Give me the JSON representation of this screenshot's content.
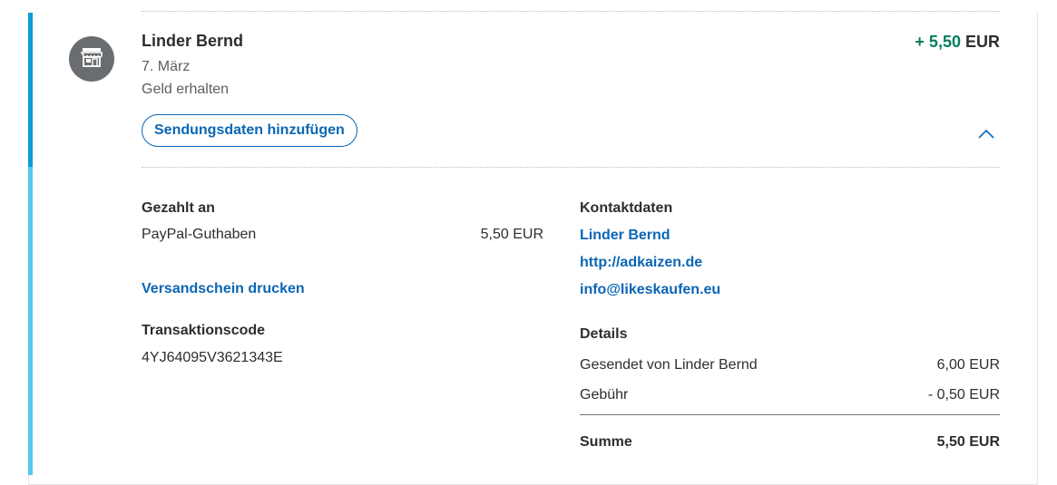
{
  "transaction": {
    "name": "Linder Bernd",
    "date": "7. März",
    "status": "Geld erhalten",
    "amount_sign_value": "+ 5,50",
    "amount_currency": "EUR",
    "shipping_button": "Sendungsdaten hinzufügen"
  },
  "payment": {
    "paid_to_label": "Gezahlt an",
    "method": "PayPal-Guthaben",
    "method_amount": "5,50 EUR",
    "print_label": "Versandschein drucken",
    "code_label": "Transaktionscode",
    "code": "4YJ64095V3621343E"
  },
  "contact": {
    "label": "Kontaktdaten",
    "name": "Linder Bernd",
    "website": "http://adkaizen.de",
    "email": "info@likeskaufen.eu"
  },
  "details": {
    "label": "Details",
    "rows": [
      {
        "label": "Gesendet von Linder Bernd",
        "value": "6,00 EUR"
      },
      {
        "label": "Gebühr",
        "value": "- 0,50 EUR"
      }
    ],
    "total_label": "Summe",
    "total_value": "5,50 EUR"
  },
  "icons": {
    "avatar": "store-icon",
    "toggle": "chevron-up-icon"
  },
  "colors": {
    "accent": "#0a9bd8",
    "accent_light": "#57c6f1",
    "link": "#0a66b5",
    "positive": "#017d5b"
  }
}
